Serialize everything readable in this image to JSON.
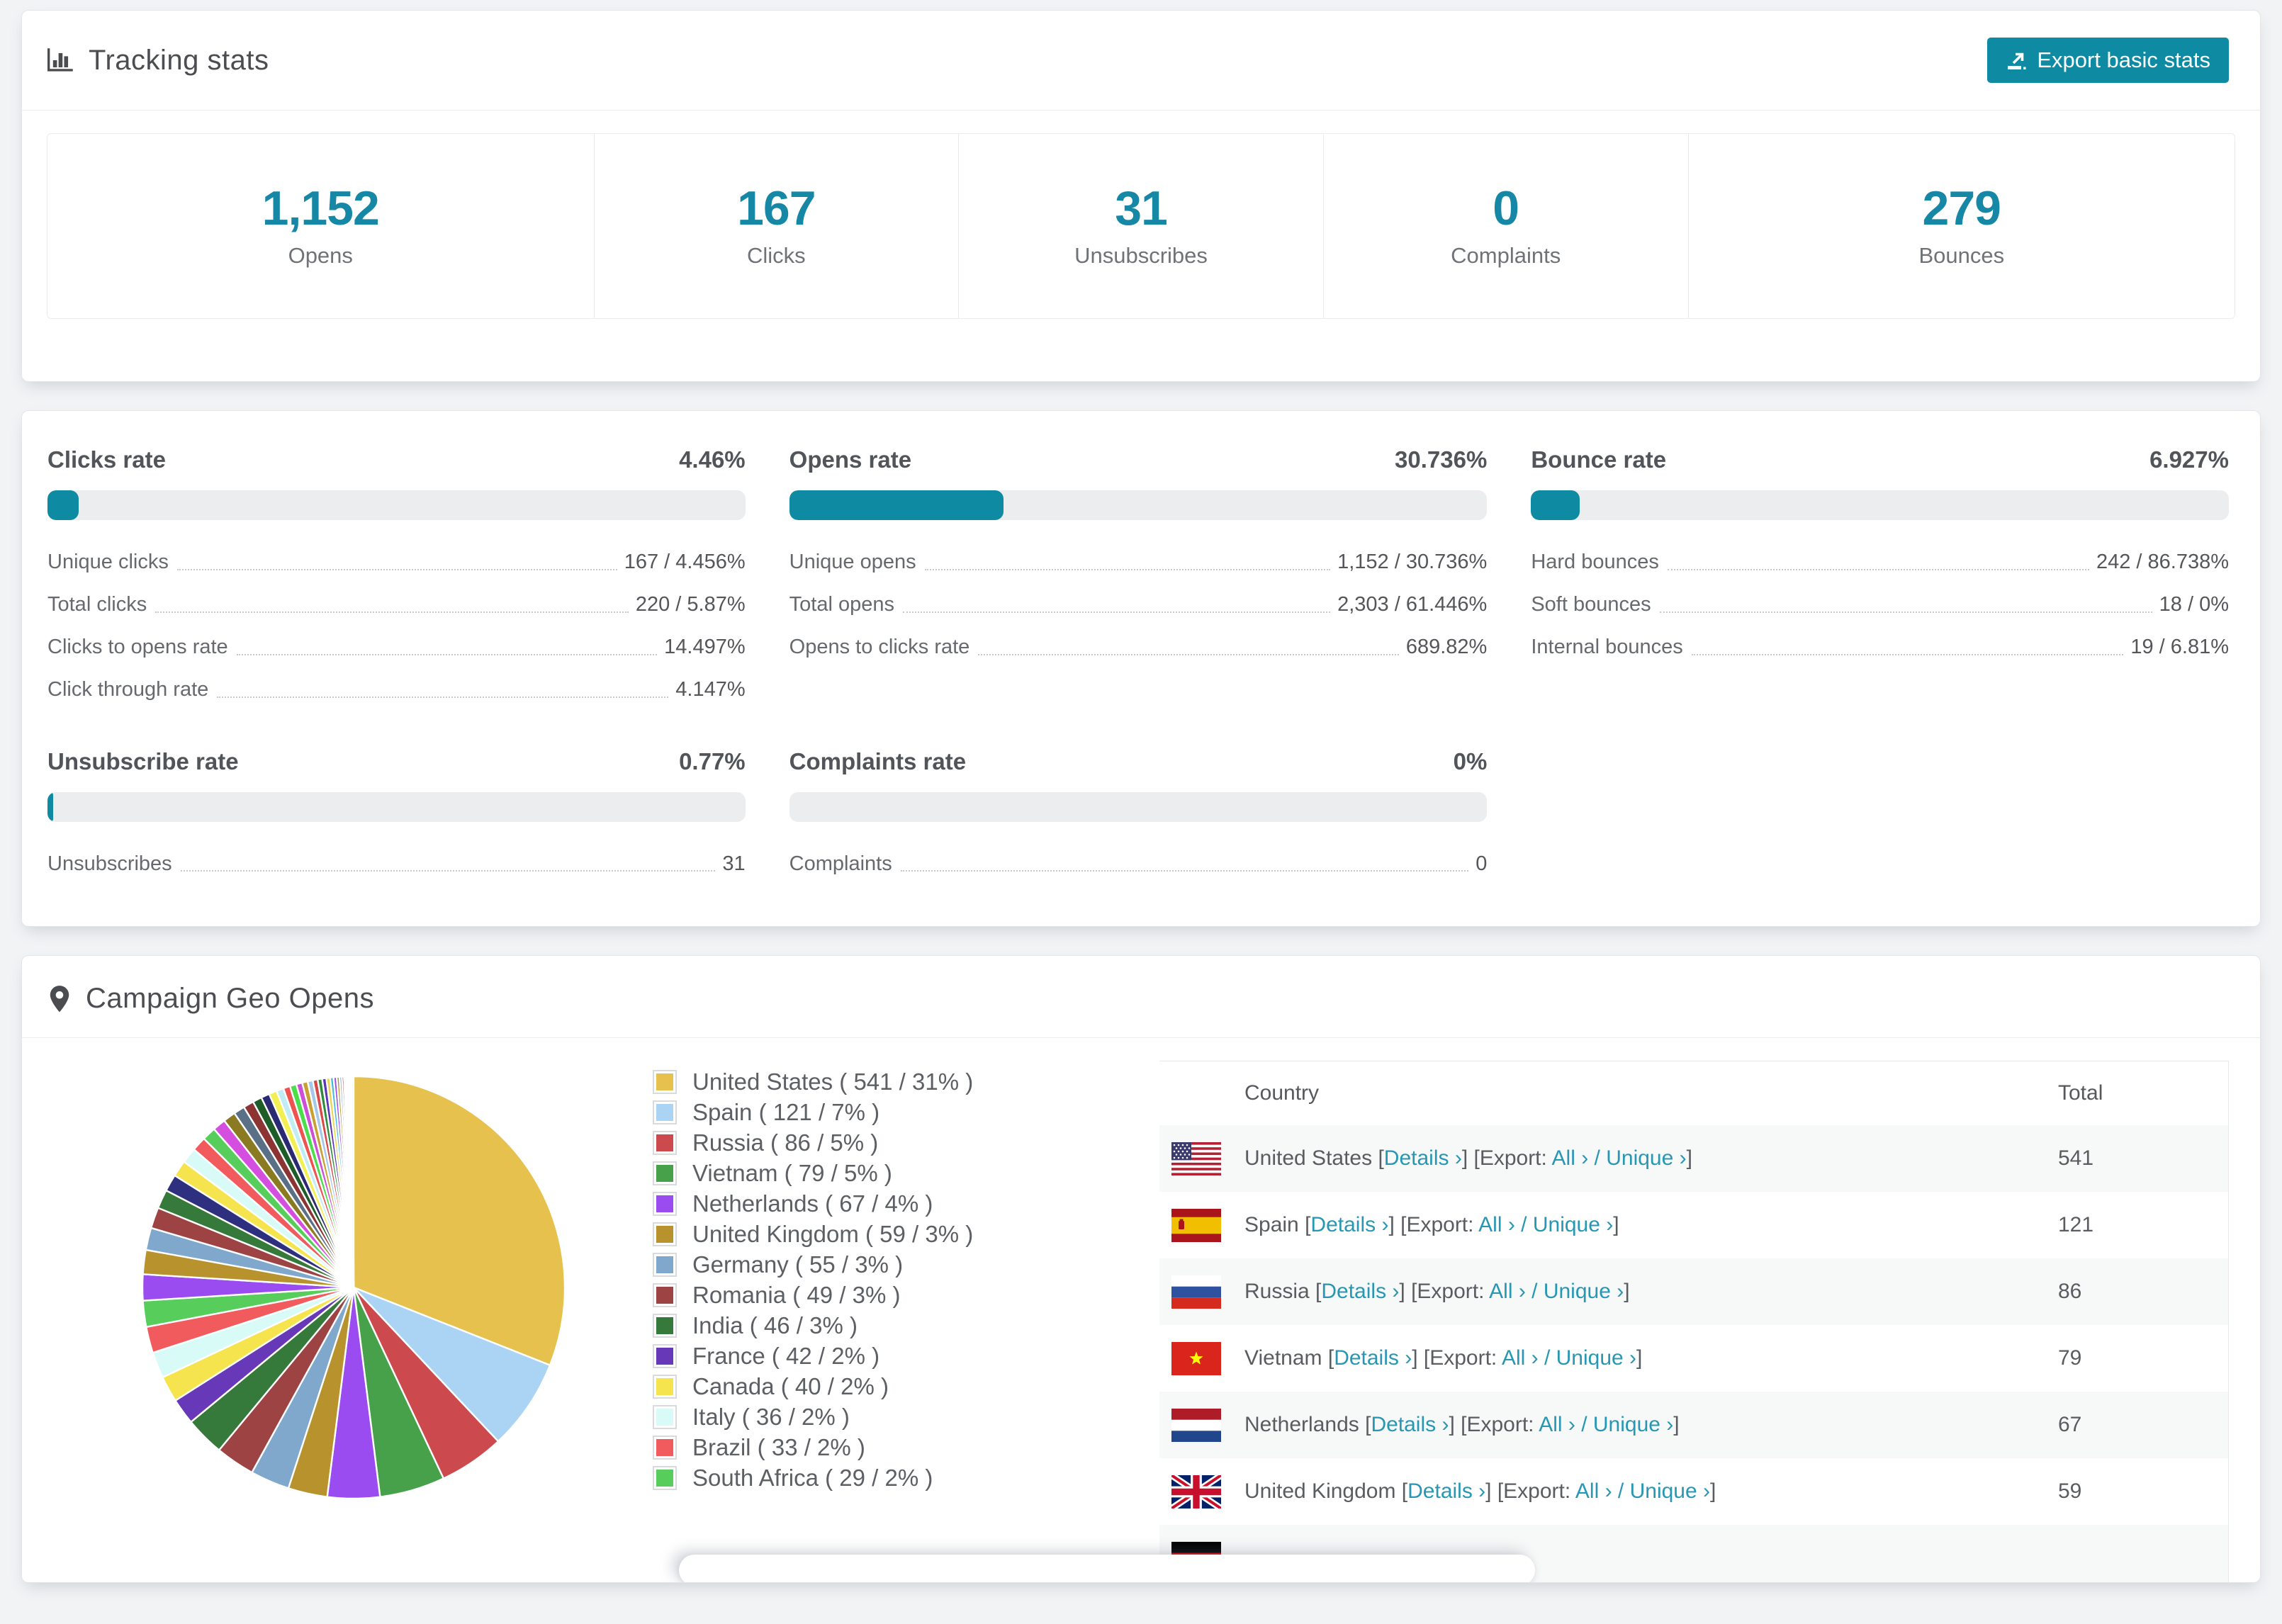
{
  "colors": {
    "accent": "#0f8aa3",
    "link": "#2797b4",
    "number_teal": "#1787a6"
  },
  "tracking": {
    "title": "Tracking stats",
    "export_button": "Export basic stats",
    "stats": [
      {
        "value": "1,152",
        "label": "Opens"
      },
      {
        "value": "167",
        "label": "Clicks"
      },
      {
        "value": "31",
        "label": "Unsubscribes"
      },
      {
        "value": "0",
        "label": "Complaints"
      },
      {
        "value": "279",
        "label": "Bounces"
      }
    ]
  },
  "rates": {
    "sections": [
      {
        "title": "Clicks rate",
        "value": "4.46%",
        "percent": 4.46,
        "rows": [
          {
            "label": "Unique clicks",
            "value": "167 / 4.456%"
          },
          {
            "label": "Total clicks",
            "value": "220 / 5.87%"
          },
          {
            "label": "Clicks to opens rate",
            "value": "14.497%"
          },
          {
            "label": "Click through rate",
            "value": "4.147%"
          }
        ]
      },
      {
        "title": "Opens rate",
        "value": "30.736%",
        "percent": 30.736,
        "rows": [
          {
            "label": "Unique opens",
            "value": "1,152 / 30.736%"
          },
          {
            "label": "Total opens",
            "value": "2,303 / 61.446%"
          },
          {
            "label": "Opens to clicks rate",
            "value": "689.82%"
          }
        ]
      },
      {
        "title": "Bounce rate",
        "value": "6.927%",
        "percent": 6.927,
        "rows": [
          {
            "label": "Hard bounces",
            "value": "242 / 86.738%"
          },
          {
            "label": "Soft bounces",
            "value": "18 / 0%"
          },
          {
            "label": "Internal bounces",
            "value": "19 / 6.81%"
          }
        ]
      },
      {
        "title": "Unsubscribe rate",
        "value": "0.77%",
        "percent": 0.77,
        "rows": [
          {
            "label": "Unsubscribes",
            "value": "31"
          }
        ]
      },
      {
        "title": "Complaints rate",
        "value": "0%",
        "percent": 0,
        "rows": [
          {
            "label": "Complaints",
            "value": "0"
          }
        ]
      }
    ]
  },
  "geo": {
    "title": "Campaign Geo Opens",
    "table": {
      "headers": [
        "Country",
        "Total"
      ],
      "links": {
        "details": "Details",
        "export_prefix": "[Export:",
        "all": "All",
        "unique": "Unique"
      },
      "rows": [
        {
          "flag": "us",
          "country": "United States",
          "total": "541"
        },
        {
          "flag": "es",
          "country": "Spain",
          "total": "121"
        },
        {
          "flag": "ru",
          "country": "Russia",
          "total": "86"
        },
        {
          "flag": "vn",
          "country": "Vietnam",
          "total": "79"
        },
        {
          "flag": "nl",
          "country": "Netherlands",
          "total": "67"
        },
        {
          "flag": "gb",
          "country": "United Kingdom",
          "total": "59"
        },
        {
          "flag": "de",
          "country": "",
          "total": ""
        }
      ]
    },
    "chart_data": {
      "type": "pie",
      "title": "Campaign Geo Opens",
      "legend_position": "right",
      "start_angle_deg": -90,
      "slices": [
        {
          "label": "United States",
          "count": 541,
          "percent": 31,
          "color": "#e6c14d"
        },
        {
          "label": "Spain",
          "count": 121,
          "percent": 7,
          "color": "#abd4f4"
        },
        {
          "label": "Russia",
          "count": 86,
          "percent": 5,
          "color": "#cc4a4d"
        },
        {
          "label": "Vietnam",
          "count": 79,
          "percent": 5,
          "color": "#47a14b"
        },
        {
          "label": "Netherlands",
          "count": 67,
          "percent": 4,
          "color": "#9b4cf0"
        },
        {
          "label": "United Kingdom",
          "count": 59,
          "percent": 3,
          "color": "#b8932d"
        },
        {
          "label": "Germany",
          "count": 55,
          "percent": 3,
          "color": "#7fa8cc"
        },
        {
          "label": "Romania",
          "count": 49,
          "percent": 3,
          "color": "#9e4343"
        },
        {
          "label": "India",
          "count": 46,
          "percent": 3,
          "color": "#35793b"
        },
        {
          "label": "France",
          "count": 42,
          "percent": 2,
          "color": "#6739b8"
        },
        {
          "label": "Canada",
          "count": 40,
          "percent": 2,
          "color": "#f6e44e"
        },
        {
          "label": "Italy",
          "count": 36,
          "percent": 2,
          "color": "#d9fbf7"
        },
        {
          "label": "Brazil",
          "count": 33,
          "percent": 2,
          "color": "#f15b5e"
        },
        {
          "label": "South Africa",
          "count": 29,
          "percent": 2,
          "color": "#57ce5b"
        }
      ],
      "other_slices_percent": [
        2.0,
        1.85,
        1.7,
        1.6,
        1.45,
        1.3,
        1.25,
        1.2,
        1.1,
        1.05,
        1.0,
        0.95,
        0.85,
        0.8,
        0.7,
        0.65,
        0.6,
        0.55,
        0.52,
        0.5,
        0.46,
        0.42,
        0.4,
        0.37,
        0.34,
        0.32,
        0.29,
        0.26,
        0.24,
        0.21,
        0.18,
        0.16,
        0.13,
        0.12,
        0.11,
        0.09,
        0.08,
        0.07,
        0.05,
        0.04
      ],
      "other_palette": [
        "#9b4cf0",
        "#b8932d",
        "#7fa8cc",
        "#9e4343",
        "#35793b",
        "#2f2f80",
        "#f6e44e",
        "#d9fbf7",
        "#f15b5e",
        "#57ce5b",
        "#d44fe0",
        "#8a7a22",
        "#5a7086",
        "#8c3434",
        "#1e5c28",
        "#2a2a72",
        "#f2ef52",
        "#c2ecf4",
        "#ef5350",
        "#4ade4b",
        "#cc4fd8",
        "#c8a032",
        "#a4c8ea",
        "#d84848",
        "#2e8b3c",
        "#5a35bb",
        "#e8d44f",
        "#46b8d8"
      ]
    }
  }
}
